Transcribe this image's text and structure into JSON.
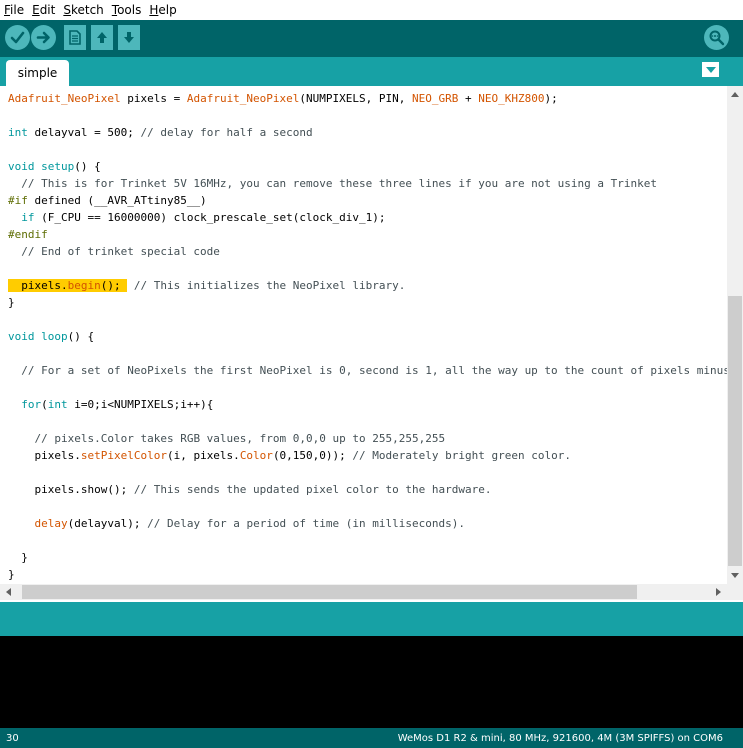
{
  "menubar": {
    "items": [
      {
        "pre": "",
        "ul": "F",
        "post": "ile"
      },
      {
        "pre": "",
        "ul": "E",
        "post": "dit"
      },
      {
        "pre": "",
        "ul": "S",
        "post": "ketch"
      },
      {
        "pre": "",
        "ul": "T",
        "post": "ools"
      },
      {
        "pre": "",
        "ul": "H",
        "post": "elp"
      }
    ]
  },
  "toolbar": {
    "buttons": [
      "verify-icon",
      "upload-icon",
      "new-icon",
      "open-icon",
      "save-icon",
      "serial-monitor-icon"
    ]
  },
  "tabs": [
    {
      "label": "simple"
    }
  ],
  "code": {
    "lines": [
      [
        {
          "c": "fn",
          "t": "Adafruit_NeoPixel"
        },
        {
          "c": "",
          "t": " pixels = "
        },
        {
          "c": "fn",
          "t": "Adafruit_NeoPixel"
        },
        {
          "c": "",
          "t": "(NUMPIXELS, PIN, "
        },
        {
          "c": "fn",
          "t": "NEO_GRB"
        },
        {
          "c": "",
          "t": " + "
        },
        {
          "c": "fn",
          "t": "NEO_KHZ800"
        },
        {
          "c": "",
          "t": ");"
        }
      ],
      [],
      [
        {
          "c": "ty",
          "t": "int"
        },
        {
          "c": "",
          "t": " delayval = 500; "
        },
        {
          "c": "cm",
          "t": "// delay for half a second"
        }
      ],
      [],
      [
        {
          "c": "ty",
          "t": "void"
        },
        {
          "c": "",
          "t": " "
        },
        {
          "c": "kw",
          "t": "setup"
        },
        {
          "c": "",
          "t": "() {"
        }
      ],
      [
        {
          "c": "",
          "t": "  "
        },
        {
          "c": "cm",
          "t": "// This is for Trinket 5V 16MHz, you can remove these three lines if you are not using a Trinket"
        }
      ],
      [
        {
          "c": "pp",
          "t": "#if"
        },
        {
          "c": "",
          "t": " defined (__AVR_ATtiny85__)"
        }
      ],
      [
        {
          "c": "",
          "t": "  "
        },
        {
          "c": "kw",
          "t": "if"
        },
        {
          "c": "",
          "t": " (F_CPU == 16000000) clock_prescale_set(clock_div_1);"
        }
      ],
      [
        {
          "c": "pp",
          "t": "#endif"
        }
      ],
      [
        {
          "c": "",
          "t": "  "
        },
        {
          "c": "cm",
          "t": "// End of trinket special code"
        }
      ],
      [],
      [
        {
          "c": "hl",
          "t": "  pixels."
        },
        {
          "c": "hl fn",
          "t": "begin"
        },
        {
          "c": "hl",
          "t": "(); "
        },
        {
          "c": "",
          "t": " "
        },
        {
          "c": "cm",
          "t": "// This initializes the NeoPixel library."
        }
      ],
      [
        {
          "c": "",
          "t": "}"
        }
      ],
      [],
      [
        {
          "c": "ty",
          "t": "void"
        },
        {
          "c": "",
          "t": " "
        },
        {
          "c": "kw",
          "t": "loop"
        },
        {
          "c": "",
          "t": "() {"
        }
      ],
      [],
      [
        {
          "c": "",
          "t": "  "
        },
        {
          "c": "cm",
          "t": "// For a set of NeoPixels the first NeoPixel is 0, second is 1, all the way up to the count of pixels minus one."
        }
      ],
      [],
      [
        {
          "c": "",
          "t": "  "
        },
        {
          "c": "kw",
          "t": "for"
        },
        {
          "c": "",
          "t": "("
        },
        {
          "c": "ty",
          "t": "int"
        },
        {
          "c": "",
          "t": " i=0;i<NUMPIXELS;i++){"
        }
      ],
      [],
      [
        {
          "c": "",
          "t": "    "
        },
        {
          "c": "cm",
          "t": "// pixels.Color takes RGB values, from 0,0,0 up to 255,255,255"
        }
      ],
      [
        {
          "c": "",
          "t": "    pixels."
        },
        {
          "c": "fn",
          "t": "setPixelColor"
        },
        {
          "c": "",
          "t": "(i, pixels."
        },
        {
          "c": "fn",
          "t": "Color"
        },
        {
          "c": "",
          "t": "(0,150,0)); "
        },
        {
          "c": "cm",
          "t": "// Moderately bright green color."
        }
      ],
      [],
      [
        {
          "c": "",
          "t": "    pixels.show(); "
        },
        {
          "c": "cm",
          "t": "// This sends the updated pixel color to the hardware."
        }
      ],
      [],
      [
        {
          "c": "",
          "t": "    "
        },
        {
          "c": "fn",
          "t": "delay"
        },
        {
          "c": "",
          "t": "(delayval); "
        },
        {
          "c": "cm",
          "t": "// Delay for a period of time (in milliseconds)."
        }
      ],
      [],
      [
        {
          "c": "",
          "t": "  }"
        }
      ],
      [
        {
          "c": "",
          "t": "}"
        }
      ]
    ]
  },
  "status": {
    "line": "30",
    "board": "WeMos D1 R2 & mini, 80 MHz, 921600, 4M (3M SPIFFS) on COM6"
  },
  "colors": {
    "toolbar": "#006468",
    "tabbar": "#17a1a5",
    "button": "#4db7bb",
    "highlight": "#ffcc00"
  }
}
